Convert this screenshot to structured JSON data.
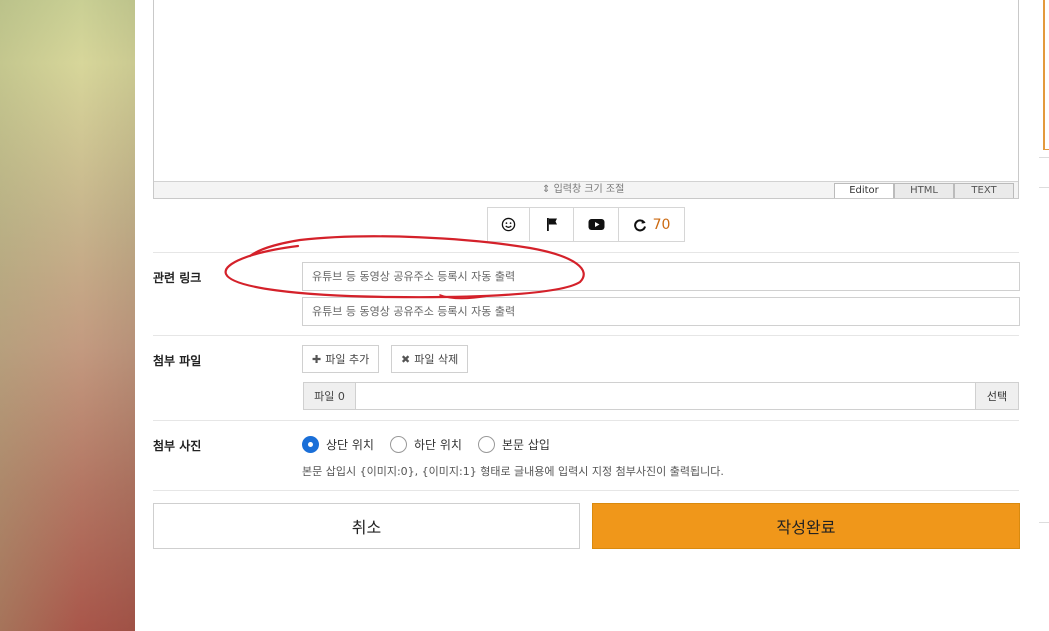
{
  "editor": {
    "resize_label": "입력창 크기 조절",
    "tabs": [
      "Editor",
      "HTML",
      "TEXT"
    ]
  },
  "toolbar": {
    "icons": [
      "smile-icon",
      "flag-icon",
      "youtube-icon",
      "refresh-icon"
    ],
    "count": "70"
  },
  "related_links": {
    "label": "관련 링크",
    "placeholder_1": "유튜브 등 동영상 공유주소 등록시 자동 출력",
    "placeholder_2": "유튜브 등 동영상 공유주소 등록시 자동 출력"
  },
  "attachments": {
    "label": "첨부 파일",
    "add_button": "파일 추가",
    "delete_button": "파일 삭제",
    "file_label": "파일 0",
    "select_button": "선택"
  },
  "photo": {
    "label": "첨부 사진",
    "options": [
      "상단 위치",
      "하단 위치",
      "본문 삽입"
    ],
    "selected": 0,
    "help": "본문 삽입시 {이미지:0}, {이미지:1} 형태로 글내용에 입력시 지정 첨부사진이 출력됩니다."
  },
  "actions": {
    "cancel": "취소",
    "submit": "작성완료"
  },
  "colors": {
    "accent": "#f0971a",
    "radio": "#1a6fd8",
    "count": "#cc6a11",
    "annotation": "#d4212a"
  }
}
